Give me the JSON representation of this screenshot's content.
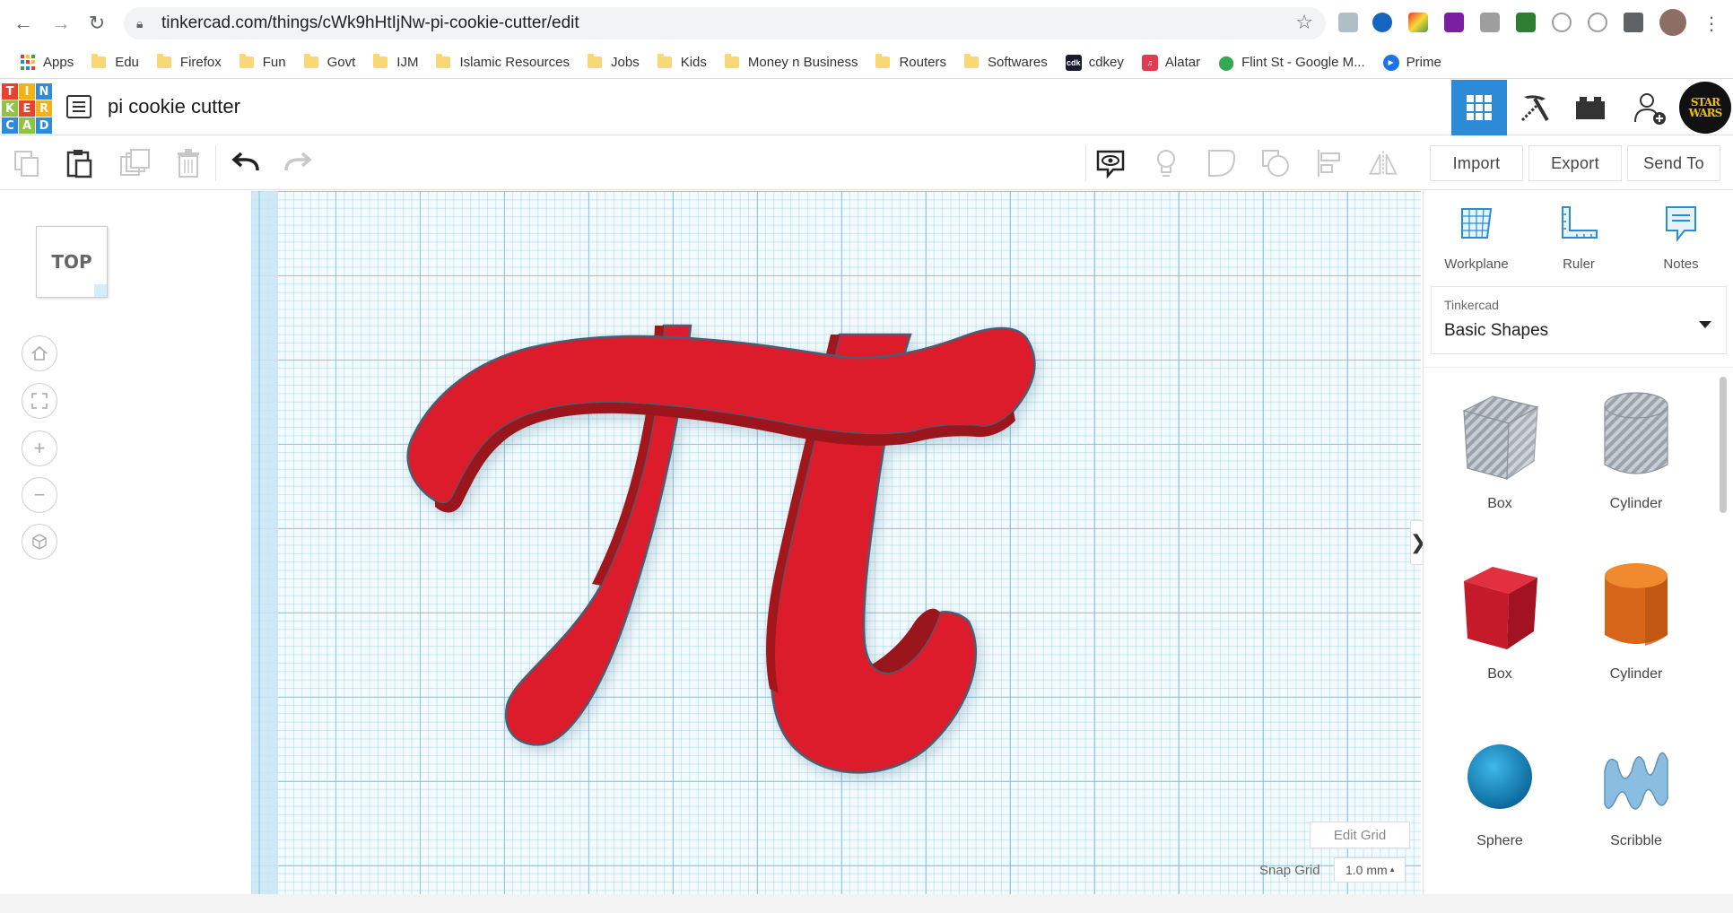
{
  "browser": {
    "url": "tinkercad.com/things/cWk9hHtIjNw-pi-cookie-cutter/edit",
    "bookmarks": [
      {
        "label": "Apps",
        "kind": "apps"
      },
      {
        "label": "Edu",
        "kind": "folder"
      },
      {
        "label": "Firefox",
        "kind": "folder"
      },
      {
        "label": "Fun",
        "kind": "folder"
      },
      {
        "label": "Govt",
        "kind": "folder"
      },
      {
        "label": "IJM",
        "kind": "folder"
      },
      {
        "label": "Islamic Resources",
        "kind": "folder"
      },
      {
        "label": "Jobs",
        "kind": "folder"
      },
      {
        "label": "Kids",
        "kind": "folder"
      },
      {
        "label": "Money n Business",
        "kind": "folder"
      },
      {
        "label": "Routers",
        "kind": "folder"
      },
      {
        "label": "Softwares",
        "kind": "folder"
      },
      {
        "label": "cdkey",
        "kind": "site-cdkey"
      },
      {
        "label": "Alatar",
        "kind": "site-alatar"
      },
      {
        "label": "Flint St - Google M...",
        "kind": "site-maps"
      },
      {
        "label": "Prime",
        "kind": "site-prime"
      }
    ]
  },
  "app": {
    "logo_letters": [
      "T",
      "I",
      "N",
      "K",
      "E",
      "R",
      "C",
      "A",
      "D"
    ],
    "logo_colors": [
      "#e8422f",
      "#f3b118",
      "#2f8ad8",
      "#8ec343",
      "#e8422f",
      "#f3b118",
      "#2f8ad8",
      "#8ec343",
      "#2f8ad8"
    ],
    "design_title": "pi cookie cutter",
    "avatar_text": "STAR WARS",
    "accent_color": "#2c8ad6"
  },
  "toolbar": {
    "import_label": "Import",
    "export_label": "Export",
    "send_to_label": "Send To"
  },
  "view": {
    "cube_face": "TOP"
  },
  "workplane": {
    "edit_grid_label": "Edit Grid",
    "snap_grid_label": "Snap Grid",
    "snap_grid_value": "1.0 mm",
    "object_color": "#dc1e2c"
  },
  "right_panel": {
    "tools": [
      {
        "label": "Workplane",
        "icon": "workplane-icon"
      },
      {
        "label": "Ruler",
        "icon": "ruler-icon"
      },
      {
        "label": "Notes",
        "icon": "notes-icon"
      }
    ],
    "category_source": "Tinkercad",
    "category_selected": "Basic Shapes",
    "shapes": [
      {
        "label": "Box",
        "variant": "hole"
      },
      {
        "label": "Cylinder",
        "variant": "hole"
      },
      {
        "label": "Box",
        "variant": "solid"
      },
      {
        "label": "Cylinder",
        "variant": "solid"
      },
      {
        "label": "Sphere",
        "variant": "solid"
      },
      {
        "label": "Scribble",
        "variant": "solid"
      }
    ]
  }
}
